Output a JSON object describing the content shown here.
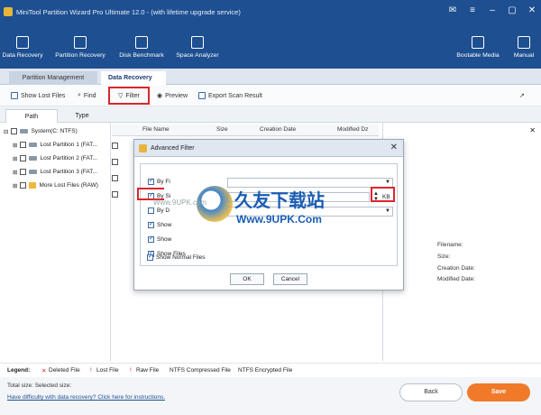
{
  "window": {
    "title": "MiniTool Partition Wizard Pro Ultimate 12.0 - (with lifetime upgrade service)"
  },
  "toolbar": {
    "items": [
      {
        "label": "Data Recovery"
      },
      {
        "label": "Partition Recovery"
      },
      {
        "label": "Disk Benchmark"
      },
      {
        "label": "Space Analyzer"
      },
      {
        "label": "Bootable Media"
      },
      {
        "label": "Manual"
      }
    ]
  },
  "tabs": [
    {
      "label": "Partition Management"
    },
    {
      "label": "Data Recovery"
    }
  ],
  "actions": {
    "show_lost": "Show Lost Files",
    "find": "Find",
    "filter": "Filter",
    "preview": "Preview",
    "export": "Export Scan Result"
  },
  "pane_tabs": [
    "Path",
    "Type"
  ],
  "tree": [
    "System(C: NTFS)",
    "Lost Partition 1 (FAT...",
    "Lost Partition 2 (FAT...",
    "Lost Partition 3 (FAT...",
    "More Lost Files (RAW)"
  ],
  "grid_headers": [
    "File Name",
    "Size",
    "Creation Date",
    "Modified Dz"
  ],
  "details": [
    "Filename:",
    "Size:",
    "Creation Date:",
    "Modified Date:"
  ],
  "dialog": {
    "title": "Advanced Filter",
    "rows": [
      "By Fi",
      "By Si",
      "By D",
      "Show",
      "Show",
      "Show     Files",
      "Show Normal Files"
    ],
    "unit": "KB",
    "ok": "OK",
    "cancel": "Cancel"
  },
  "watermark": {
    "cn": "久友下载站",
    "url": "Www.9UPK.Com",
    "small": "Www.9UPK.com"
  },
  "legend": {
    "label": "Legend:",
    "items": [
      "Deleted File",
      "Lost File",
      "Raw File",
      "NTFS Compressed File",
      "NTFS Encrypted File"
    ]
  },
  "footer": {
    "total": "Total size:  Selected size:",
    "help": "Have difficulty with data recovery? Click here for instructions.",
    "back": "Back",
    "save": "Save"
  }
}
